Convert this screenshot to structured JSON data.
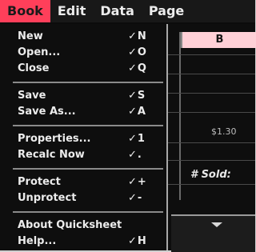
{
  "menubar": {
    "items": [
      "Book",
      "Edit",
      "Data",
      "Page"
    ],
    "active": "Book",
    "active_color": "#ff3f5a"
  },
  "book_menu": {
    "items": [
      {
        "label": "New",
        "shortcut": "✓N"
      },
      {
        "label": "Open...",
        "shortcut": "✓O"
      },
      {
        "label": "Close",
        "shortcut": "✓Q"
      },
      {
        "label": "Save",
        "shortcut": "✓S"
      },
      {
        "label": "Save As...",
        "shortcut": "✓A"
      },
      {
        "label": "Properties...",
        "shortcut": "✓1"
      },
      {
        "label": "Recalc Now",
        "shortcut": "✓."
      },
      {
        "label": "Protect",
        "shortcut": "✓+"
      },
      {
        "label": "Unprotect",
        "shortcut": "✓-"
      },
      {
        "label": "About Quicksheet",
        "shortcut": ""
      },
      {
        "label": "Help...",
        "shortcut": "✓H"
      }
    ]
  },
  "sheet": {
    "column_b": "B",
    "money_cell": "$1.30",
    "label_cell": "# Sold:",
    "header_color": "#ffd0d7"
  }
}
